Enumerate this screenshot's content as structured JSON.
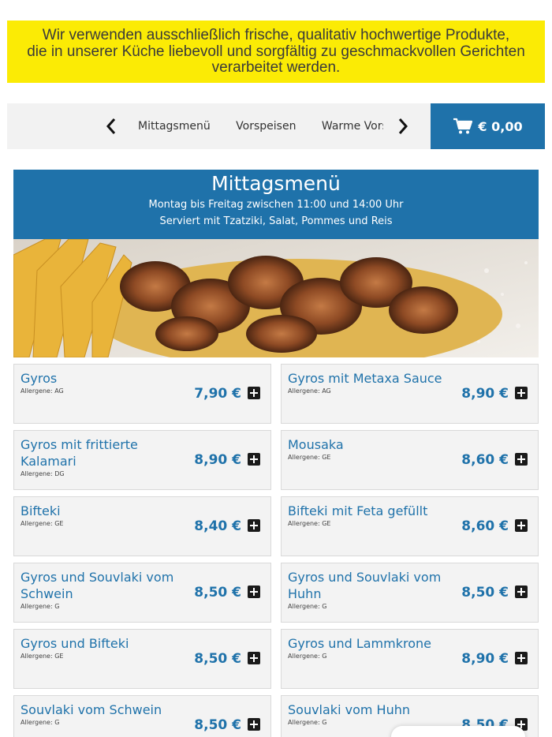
{
  "notice": {
    "lines": [
      "Wir verwenden ausschließlich frische, qualitativ hochwertige Produkte,",
      "die in unserer Küche liebevoll und sorgfältig zu geschmackvollen Gerichten",
      "verarbeitet werden."
    ]
  },
  "nav": {
    "tabs": [
      "Mittagsmenü",
      "Vorspeisen",
      "Warme Vorspe"
    ]
  },
  "cart": {
    "total": "€ 0,00"
  },
  "section": {
    "title": "Mittagsmenü",
    "line1": "Montag bis Freitag zwischen 11:00 und 14:00 Uhr",
    "line2": "Serviert mit Tzatziki, Salat, Pommes und Reis"
  },
  "items": [
    {
      "name": "Gyros",
      "allergen": "Allergene: AG",
      "price": "7,90 €"
    },
    {
      "name": "Gyros mit Metaxa Sauce",
      "allergen": "Allergene: AG",
      "price": "8,90 €"
    },
    {
      "name": "Gyros mit frittierte Kalamari",
      "allergen": "Allergene: DG",
      "price": "8,90 €"
    },
    {
      "name": "Mousaka",
      "allergen": "Allergene: GE",
      "price": "8,60 €"
    },
    {
      "name": "Bifteki",
      "allergen": "Allergene: GE",
      "price": "8,40 €"
    },
    {
      "name": "Bifteki mit Feta gefüllt",
      "allergen": "Allergene: GE",
      "price": "8,60 €"
    },
    {
      "name": "Gyros und Souvlaki vom Schwein",
      "allergen": "Allergene: G",
      "price": "8,50 €"
    },
    {
      "name": "Gyros und Souvlaki vom Huhn",
      "allergen": "Allergene: G",
      "price": "8,50 €"
    },
    {
      "name": "Gyros und Bifteki",
      "allergen": "Allergene: GE",
      "price": "8,50 €"
    },
    {
      "name": "Gyros und Lammkrone",
      "allergen": "Allergene: G",
      "price": "8,90 €"
    },
    {
      "name": "Souvlaki vom Schwein",
      "allergen": "Allergene: G",
      "price": "8,50 €"
    },
    {
      "name": "Souvlaki vom Huhn",
      "allergen": "Allergene: G",
      "price": "8,50 €"
    }
  ],
  "icons": {
    "prev": "chevron-left-icon",
    "next": "chevron-right-icon",
    "cart": "shopping-cart-icon",
    "add": "plus-square-icon"
  },
  "colors": {
    "brand_blue": "#1f72aa",
    "notice_yellow": "#fbeb05",
    "card_bg": "#f3f3f3"
  }
}
